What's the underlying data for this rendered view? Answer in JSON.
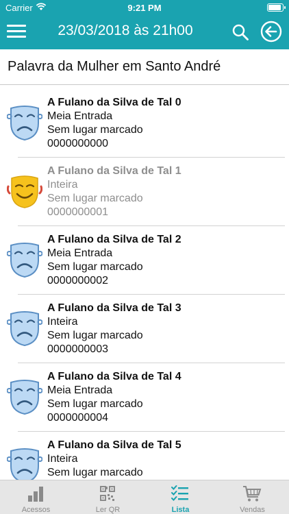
{
  "status_bar": {
    "carrier": "Carrier",
    "time": "9:21 PM",
    "battery_level": 0.95
  },
  "nav": {
    "title": "23/03/2018 às 21h00",
    "icons": [
      "menu-icon",
      "search-icon",
      "back-arrow-icon"
    ]
  },
  "event_title": "Palavra da Mulher em Santo André",
  "tickets": [
    {
      "name": "A Fulano da Silva de Tal 0",
      "type": "Meia Entrada",
      "seat": "Sem lugar marcado",
      "code": "0000000000",
      "icon": "sad-mask-icon",
      "used": false
    },
    {
      "name": "A Fulano da Silva de Tal 1",
      "type": "Inteira",
      "seat": "Sem lugar marcado",
      "code": "0000000001",
      "icon": "happy-mask-icon",
      "used": true
    },
    {
      "name": "A Fulano da Silva de Tal 2",
      "type": "Meia Entrada",
      "seat": "Sem lugar marcado",
      "code": "0000000002",
      "icon": "sad-mask-icon",
      "used": false
    },
    {
      "name": "A Fulano da Silva de Tal 3",
      "type": "Inteira",
      "seat": "Sem lugar marcado",
      "code": "0000000003",
      "icon": "sad-mask-icon",
      "used": false
    },
    {
      "name": "A Fulano da Silva de Tal 4",
      "type": "Meia Entrada",
      "seat": "Sem lugar marcado",
      "code": "0000000004",
      "icon": "sad-mask-icon",
      "used": false
    },
    {
      "name": "A Fulano da Silva de Tal 5",
      "type": "Inteira",
      "seat": "Sem lugar marcado",
      "code": "",
      "icon": "sad-mask-icon",
      "used": false
    }
  ],
  "tabs": [
    {
      "label": "Acessos",
      "icon": "bar-chart-icon",
      "active": false
    },
    {
      "label": "Ler QR",
      "icon": "qr-code-icon",
      "active": false
    },
    {
      "label": "Lista",
      "icon": "checklist-icon",
      "active": true
    },
    {
      "label": "Vendas",
      "icon": "cart-icon",
      "active": false
    }
  ],
  "colors": {
    "accent": "#1aa3b0",
    "mask_blue": "#bcd9f4",
    "mask_gold": "#f6c21d",
    "dim_text": "#8e8e8e"
  }
}
